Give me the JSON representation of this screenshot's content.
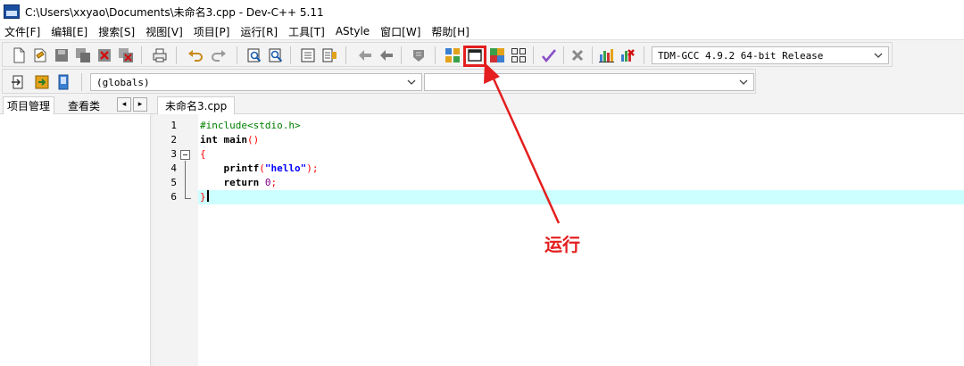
{
  "window": {
    "title": "C:\\Users\\xxyao\\Documents\\未命名3.cpp - Dev-C++ 5.11"
  },
  "menu": [
    "文件[F]",
    "编辑[E]",
    "搜索[S]",
    "视图[V]",
    "项目[P]",
    "运行[R]",
    "工具[T]",
    "AStyle",
    "窗口[W]",
    "帮助[H]"
  ],
  "toolbar": {
    "compiler_select": "TDM-GCC 4.9.2 64-bit Release",
    "scope_select": "(globals)",
    "symbol_select": ""
  },
  "left_panel": {
    "tabs": [
      "项目管理",
      "查看类"
    ],
    "nav_prev": "◂",
    "nav_next": "▸"
  },
  "editor": {
    "tab": "未命名3.cpp",
    "line_numbers": [
      "1",
      "2",
      "3",
      "4",
      "5",
      "6"
    ],
    "code": {
      "l1": "#include<stdio.h>",
      "l2_kw": "int",
      "l2_rest": " main",
      "l2_paren": "()",
      "l3": "{",
      "l4_indent": "    printf",
      "l4_open": "(",
      "l4_str": "\"hello\"",
      "l4_close": ");",
      "l5_kw": "    return",
      "l5_sp": " ",
      "l5_num": "0",
      "l5_semi": ";",
      "l6": "}"
    }
  },
  "annotation": {
    "label": "运行",
    "color": "#e41e1e"
  },
  "icons": [
    "new-file-icon",
    "open-icon",
    "save-icon",
    "save-all-icon",
    "close-icon",
    "close-all-icon",
    "print-icon",
    "undo-icon",
    "redo-icon",
    "find-icon",
    "replace-icon",
    "goto-icon",
    "bookmark-icon",
    "indent-icon",
    "unindent-icon",
    "comment-icon",
    "compile-icon",
    "run-icon",
    "compile-run-icon",
    "rebuild-icon",
    "syntax-check-icon",
    "clean-icon",
    "profile-icon",
    "delete-profile-icon"
  ]
}
